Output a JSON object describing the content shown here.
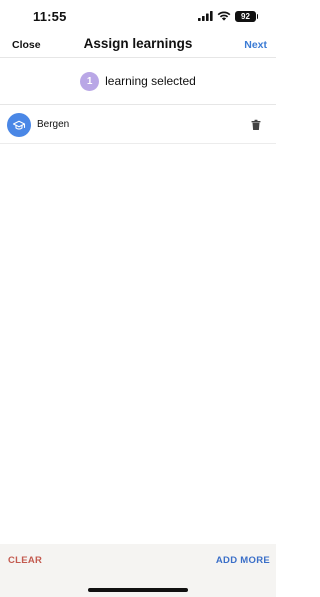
{
  "status_bar": {
    "time": "11:55",
    "battery": "92",
    "icons": [
      "signal-icon",
      "wifi-icon",
      "battery-icon"
    ]
  },
  "nav": {
    "close_label": "Close",
    "title": "Assign learnings",
    "next_label": "Next"
  },
  "selection": {
    "count": "1",
    "label": "learning selected"
  },
  "items": [
    {
      "label": "Bergen",
      "icon": "graduation-cap-icon",
      "action_icon": "trash-icon"
    }
  ],
  "footer": {
    "clear_label": "CLEAR",
    "add_more_label": "ADD MORE"
  },
  "colors": {
    "accent_blue": "#3b7bd4",
    "badge_purple": "#b9a7e6",
    "avatar_blue": "#4a87e6",
    "clear_red": "#c35a4f",
    "footer_bg": "#f5f4f2"
  }
}
